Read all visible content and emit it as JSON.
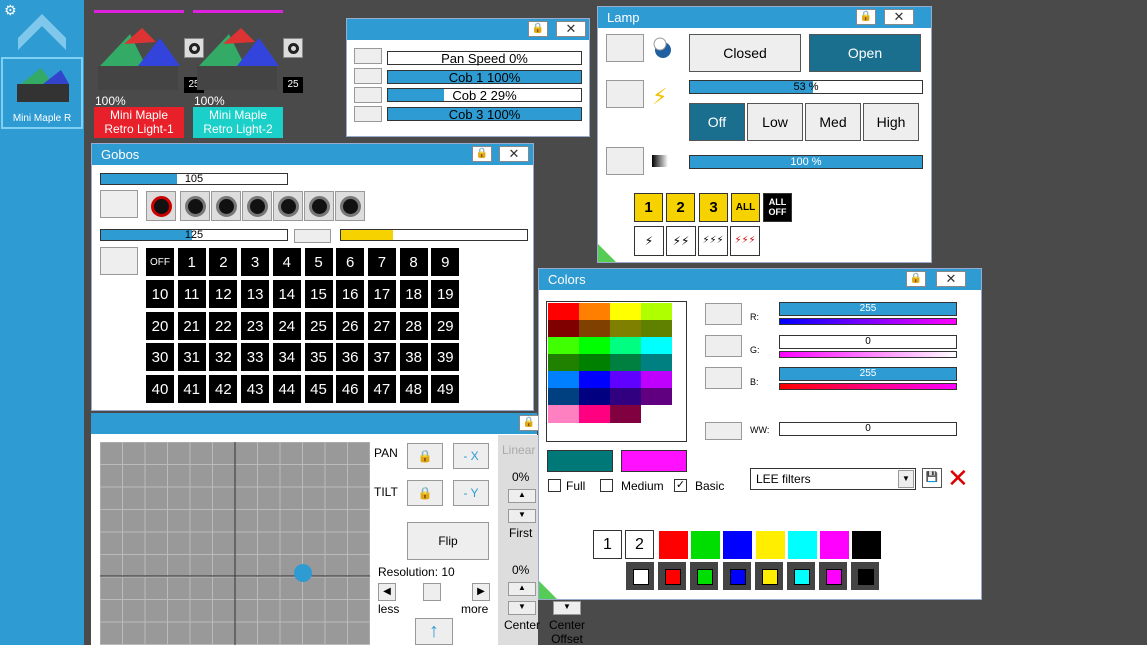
{
  "sidebar": {
    "fixture_label": "Mini Maple R"
  },
  "fixtures": [
    {
      "pct": "100%",
      "name": "Mini Maple Retro Light-1",
      "num": "25",
      "color": "#e8202a"
    },
    {
      "pct": "100%",
      "name": "Mini Maple Retro Light-2",
      "num": "25",
      "color": "#1ad0c8"
    }
  ],
  "pan_window": {
    "rows": [
      {
        "label": "Pan Speed    0%",
        "value": 0
      },
      {
        "label": "Cob 1    100%",
        "value": 100
      },
      {
        "label": "Cob 2   29%",
        "value": 29
      },
      {
        "label": "Cob 3    100%",
        "value": 100
      }
    ]
  },
  "gobos": {
    "title": "Gobos",
    "slider1": {
      "text": "105",
      "value": 41
    },
    "slider2": {
      "text": "125",
      "value": 49
    },
    "grid": [
      "OFF",
      "1",
      "2",
      "3",
      "4",
      "5",
      "6",
      "7",
      "8",
      "9",
      "10",
      "11",
      "12",
      "13",
      "14",
      "15",
      "16",
      "17",
      "18",
      "19",
      "20",
      "21",
      "22",
      "23",
      "24",
      "25",
      "26",
      "27",
      "28",
      "29",
      "30",
      "31",
      "32",
      "33",
      "34",
      "35",
      "36",
      "37",
      "38",
      "39",
      "40",
      "41",
      "42",
      "43",
      "44",
      "45",
      "46",
      "47",
      "48",
      "49"
    ]
  },
  "lamp": {
    "title": "Lamp",
    "closed": "Closed",
    "open": "Open",
    "intensity": {
      "text": "53 %",
      "value": 53
    },
    "speed": [
      "Off",
      "Low",
      "Med",
      "High"
    ],
    "dimmer": {
      "text": "100 %",
      "value": 100
    },
    "zones": [
      "1",
      "2",
      "3",
      "ALL",
      "ALL OFF"
    ]
  },
  "colors": {
    "title": "Colors",
    "r": {
      "label": "R:",
      "text": "255",
      "value": 100
    },
    "g": {
      "label": "G:",
      "text": "0",
      "value": 0
    },
    "b": {
      "label": "B:",
      "text": "255",
      "value": 100
    },
    "ww": {
      "label": "WW:",
      "text": "0",
      "value": 0
    },
    "palette": [
      "#ff0000",
      "#ff8000",
      "#ffff00",
      "#b0ff00",
      "#800000",
      "#804000",
      "#808000",
      "#608000",
      "#40ff00",
      "#00ff00",
      "#00ff80",
      "#00ffff",
      "#208000",
      "#008000",
      "#008040",
      "#008080",
      "#0080ff",
      "#0000ff",
      "#6000ff",
      "#c000ff",
      "#004080",
      "#000080",
      "#300080",
      "#600080",
      "#ff80c0",
      "#ff0080",
      "#800040",
      "#ffffff"
    ],
    "preview1": "#007878",
    "preview2": "#ff10ff",
    "full": "Full",
    "medium": "Medium",
    "basic": "Basic",
    "filter": "LEE filters",
    "presets": [
      "#ff0000",
      "#00dd00",
      "#0000ff",
      "#ffee00",
      "#00ffff",
      "#ff00ff",
      "#000000"
    ],
    "page1": "1",
    "page2": "2"
  },
  "pantilt": {
    "pan": "PAN",
    "tilt": "TILT",
    "neg_x": "- X",
    "neg_y": "- Y",
    "flip": "Flip",
    "resolution": "Resolution: 10",
    "less": "less",
    "more": "more",
    "linear": "Linear",
    "pct1": "0%",
    "pct2": "0%",
    "first": "First",
    "center": "Center",
    "center_offset": "Center Offset"
  }
}
